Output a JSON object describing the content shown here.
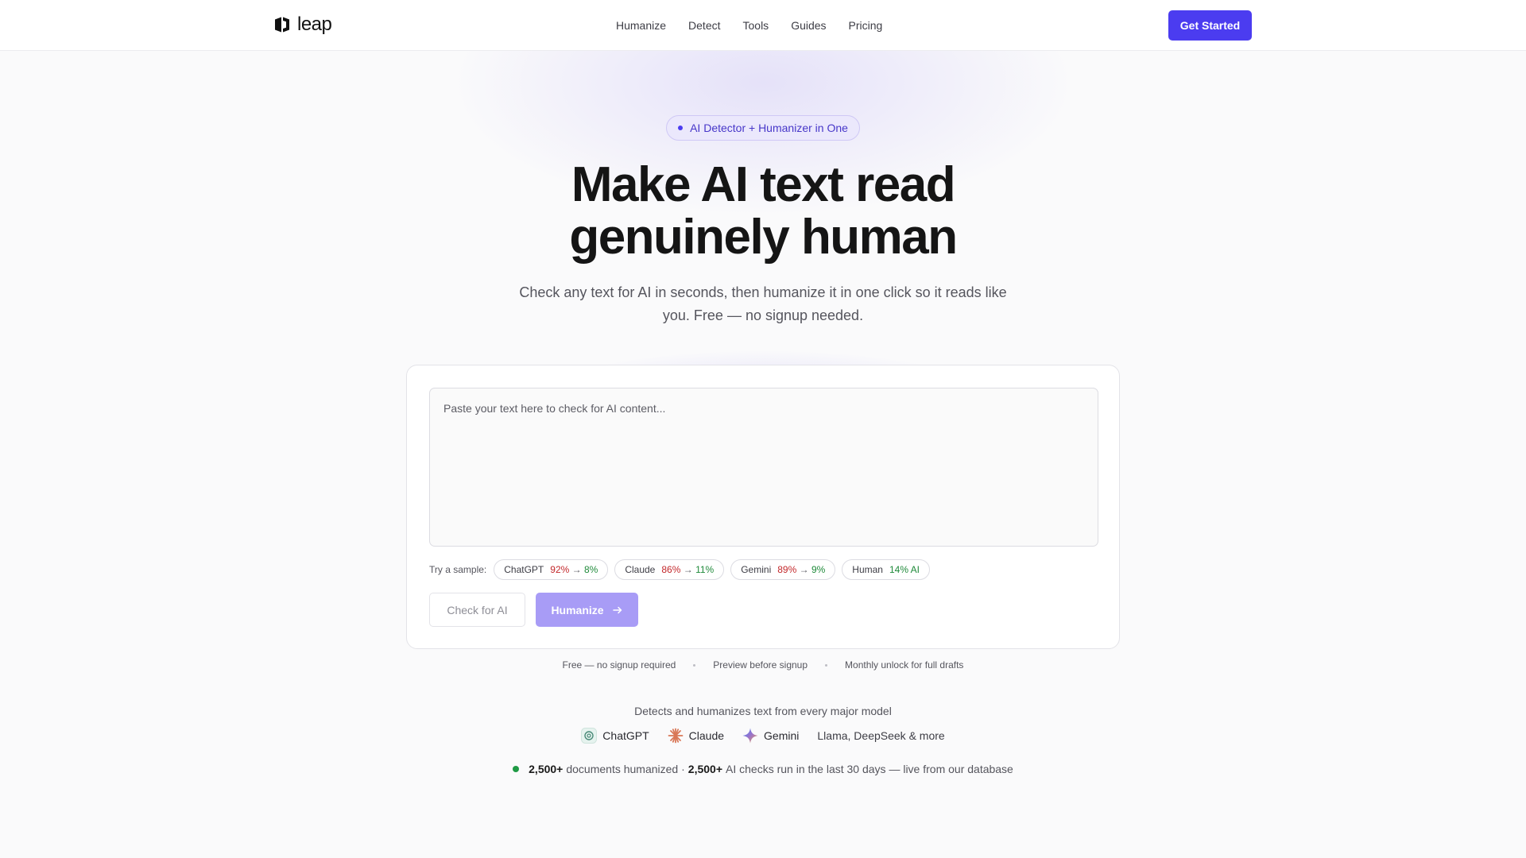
{
  "header": {
    "logo_text": "leap",
    "nav": [
      "Humanize",
      "Detect",
      "Tools",
      "Guides",
      "Pricing"
    ],
    "cta_label": "Get Started",
    "accent_color": "#4b3cf0"
  },
  "hero": {
    "badge": "AI Detector + Humanizer in One",
    "headline_line1": "Make AI text read",
    "headline_line2": "genuinely human",
    "subhead": "Check any text for AI in seconds, then humanize it in one click so it reads like you. Free — no signup needed."
  },
  "editor": {
    "placeholder": "Paste your text here to check for AI content...",
    "samples_label": "Try a sample:",
    "samples": [
      {
        "name": "ChatGPT",
        "before": "92%",
        "arrow": "→",
        "after": "8%"
      },
      {
        "name": "Claude",
        "before": "86%",
        "arrow": "→",
        "after": "11%"
      },
      {
        "name": "Gemini",
        "before": "89%",
        "arrow": "→",
        "after": "9%"
      },
      {
        "name": "Human",
        "result": "14% AI"
      }
    ],
    "check_label": "Check for AI",
    "humanize_label": "Humanize"
  },
  "features": [
    "Free — no signup required",
    "Preview before signup",
    "Monthly unlock for full drafts"
  ],
  "models": {
    "title": "Detects and humanizes text from every major model",
    "items": [
      {
        "name": "ChatGPT",
        "icon": "chatgpt-icon"
      },
      {
        "name": "Claude",
        "icon": "claude-icon"
      },
      {
        "name": "Gemini",
        "icon": "gemini-icon"
      }
    ],
    "more": "Llama, DeepSeek & more"
  },
  "stats": {
    "documents_count": "2,500+",
    "documents_text": "documents humanized ·",
    "checks_count": "2,500+",
    "checks_text": "AI checks run in the last 30 days — live from our database"
  }
}
